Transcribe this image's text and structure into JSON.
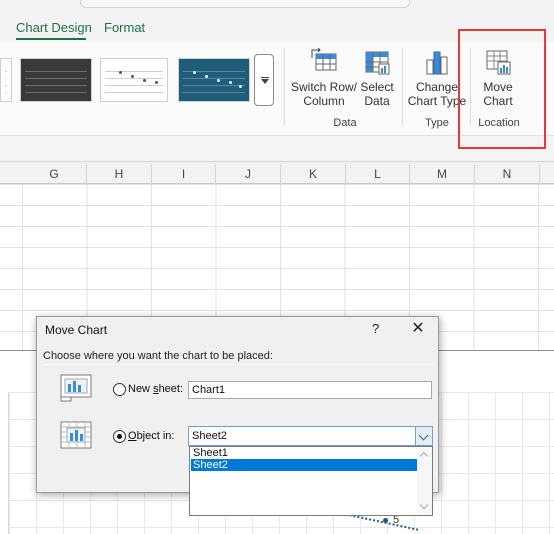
{
  "ribbon": {
    "tabs": [
      {
        "label": "Chart Design",
        "active": true
      },
      {
        "label": "Format",
        "active": false
      }
    ],
    "buttons": {
      "switch_row_column": {
        "line1": "Switch Row/",
        "line2": "Column",
        "icon": "switch-row-column-icon"
      },
      "select_data": {
        "line1": "Select",
        "line2": "Data",
        "icon": "select-data-icon"
      },
      "change_chart_type": {
        "line1": "Change",
        "line2": "Chart Type",
        "icon": "change-chart-type-icon"
      },
      "move_chart": {
        "line1": "Move",
        "line2": "Chart",
        "icon": "move-chart-icon"
      }
    },
    "groups": {
      "data": "Data",
      "type": "Type",
      "location": "Location"
    },
    "accent_color": "#1e7145",
    "highlight_color": "#e53935"
  },
  "sheet": {
    "columns": [
      "G",
      "H",
      "I",
      "J",
      "K",
      "L",
      "M",
      "N"
    ],
    "trend_point_label": "5"
  },
  "dialog": {
    "title": "Move Chart",
    "help": "?",
    "close": "✕",
    "caption": "Choose where you want the chart to be placed:",
    "new_sheet": {
      "label_prefix": "New ",
      "label_accel": "s",
      "label_suffix": "heet:",
      "value": "Chart1",
      "selected": false
    },
    "object_in": {
      "label_accel": "O",
      "label_suffix": "bject in:",
      "value": "Sheet2",
      "selected": true
    },
    "dropdown_options": [
      "Sheet1",
      "Sheet2"
    ],
    "dropdown_selected": "Sheet2",
    "selection_color": "#0078d7"
  }
}
